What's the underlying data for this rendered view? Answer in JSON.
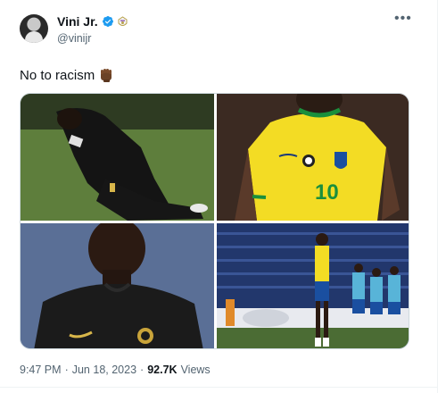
{
  "author": {
    "display_name": "Vini Jr.",
    "handle": "@vinijr",
    "avatar_icon": "profile-avatar",
    "verified_icon": "verified-badge-icon",
    "affiliation_icon": "real-madrid-crest-icon"
  },
  "more_icon": "more-options-icon",
  "tweet": {
    "text": "No to racism",
    "emoji_icon": "raised-fist-dark-skin-icon"
  },
  "media": {
    "count": 4,
    "images": [
      {
        "description_icon": "photo-player-kneeling"
      },
      {
        "description_icon": "photo-brazil-yellow-jersey"
      },
      {
        "description_icon": "photo-player-black-jersey"
      },
      {
        "description_icon": "photo-stadium-team"
      }
    ]
  },
  "meta": {
    "time": "9:47 PM",
    "sep1": "·",
    "date": "Jun 18, 2023",
    "sep2": "·",
    "views_count": "92.7K",
    "views_label": "Views"
  },
  "colors": {
    "verified_blue": "#1d9bf0",
    "secondary_text": "#536471",
    "primary_text": "#0f1419"
  }
}
